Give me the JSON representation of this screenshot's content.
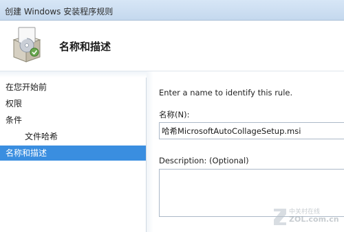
{
  "window": {
    "title": "创建 Windows 安装程序规则"
  },
  "header": {
    "icon": "installer-package-icon",
    "title": "名称和描述"
  },
  "sidebar": {
    "items": [
      {
        "label": "在您开始前"
      },
      {
        "label": "权限"
      },
      {
        "label": "条件"
      },
      {
        "label": "文件哈希"
      },
      {
        "label": "名称和描述"
      }
    ],
    "selected_index": 4
  },
  "main": {
    "instruction": "Enter a name to identify this rule.",
    "name_label": "名称(N):",
    "name_value": "哈希MicrosoftAutoCollageSetup.msi",
    "description_label": "Description: (Optional)",
    "description_value": ""
  },
  "watermark": {
    "line1": "中关村在线",
    "line2": "ZOL.com.cn"
  },
  "colors": {
    "selected_item": "#3a8ee0",
    "title_bar": "#d7e6f6"
  }
}
